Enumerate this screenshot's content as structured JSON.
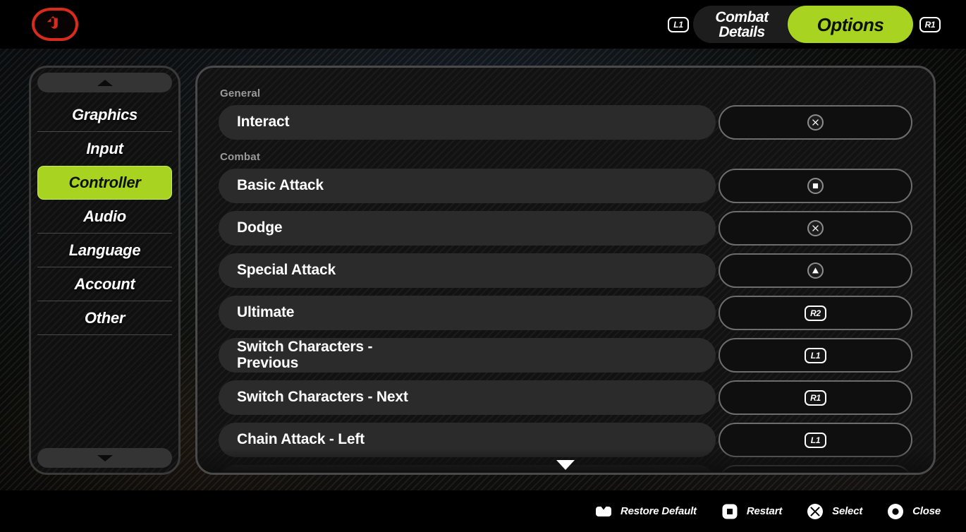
{
  "header": {
    "back_icon": "back-arrow-icon",
    "left_bumper": "L1",
    "right_bumper": "R1",
    "tabs": [
      {
        "label": "Combat\nDetails",
        "active": false
      },
      {
        "label": "Options",
        "active": true
      }
    ],
    "accent_color": "#a8d320"
  },
  "sidebar": {
    "scroll_up_icon": "triangle-up-icon",
    "scroll_down_icon": "triangle-down-icon",
    "items": [
      {
        "label": "Graphics",
        "active": false
      },
      {
        "label": "Input",
        "active": false
      },
      {
        "label": "Controller",
        "active": true
      },
      {
        "label": "Audio",
        "active": false
      },
      {
        "label": "Language",
        "active": false
      },
      {
        "label": "Account",
        "active": false
      },
      {
        "label": "Other",
        "active": false
      }
    ]
  },
  "main": {
    "scroll_down_icon": "triangle-down-icon",
    "sections": [
      {
        "title": "General",
        "rows": [
          {
            "label": "Interact",
            "binding": "cross",
            "binding_text": ""
          }
        ]
      },
      {
        "title": "Combat",
        "rows": [
          {
            "label": "Basic Attack",
            "binding": "square",
            "binding_text": ""
          },
          {
            "label": "Dodge",
            "binding": "cross",
            "binding_text": ""
          },
          {
            "label": "Special Attack",
            "binding": "triangle",
            "binding_text": ""
          },
          {
            "label": "Ultimate",
            "binding": "shoulder",
            "binding_text": "R2"
          },
          {
            "label": "Switch Characters -\nPrevious",
            "binding": "shoulder",
            "binding_text": "L1"
          },
          {
            "label": "Switch Characters - Next",
            "binding": "shoulder",
            "binding_text": "R1"
          },
          {
            "label": "Chain Attack - Left",
            "binding": "shoulder",
            "binding_text": "L1"
          }
        ]
      }
    ]
  },
  "footer": {
    "hints": [
      {
        "icon": "touchpad-icon",
        "label": "Restore Default"
      },
      {
        "icon": "square-icon",
        "label": "Restart"
      },
      {
        "icon": "cross-icon",
        "label": "Select"
      },
      {
        "icon": "circle-icon",
        "label": "Close"
      }
    ]
  }
}
